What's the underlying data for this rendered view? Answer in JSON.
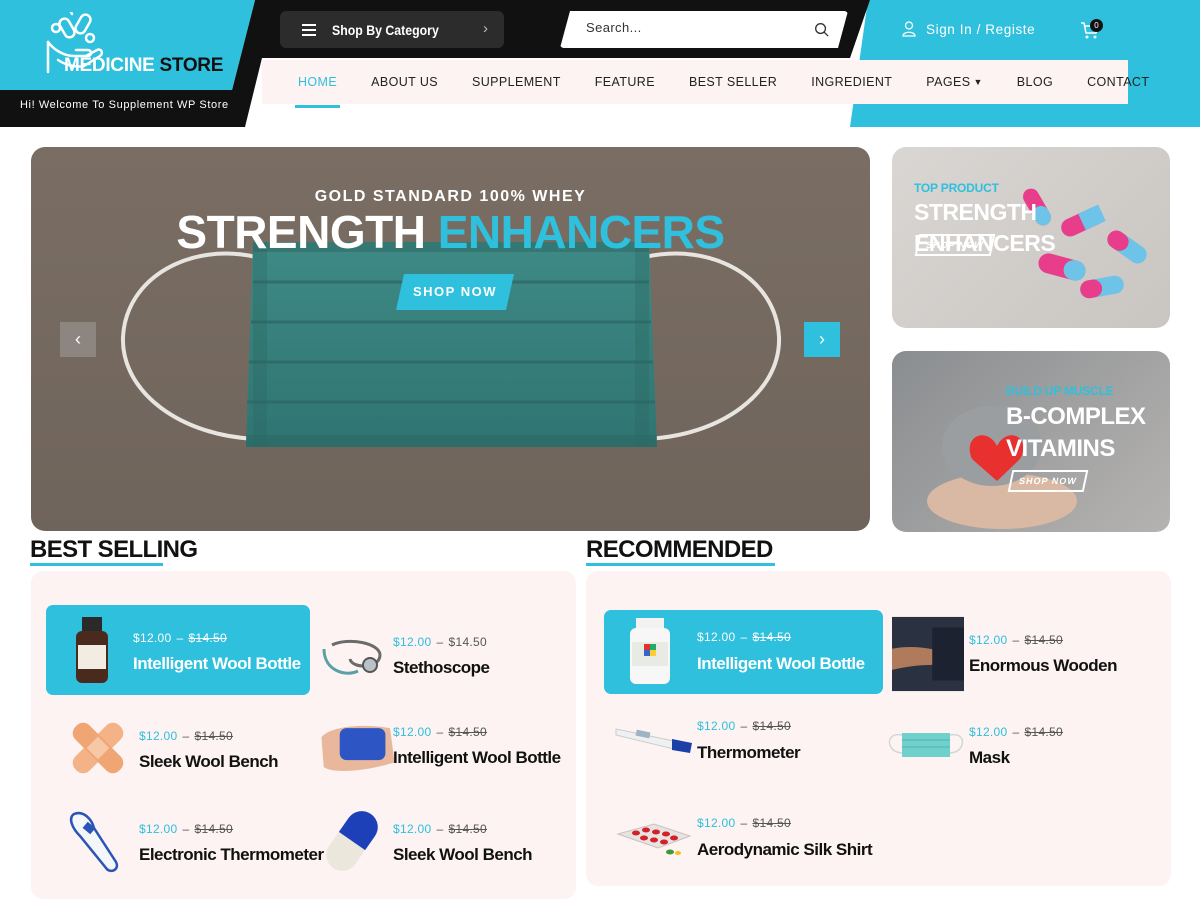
{
  "header": {
    "logo_main": "MEDICINE",
    "logo_store": "STORE",
    "welcome": "Hi! Welcome To Supplement WP Store",
    "category_button": "Shop By Category",
    "search_placeholder": "Search...",
    "signin": "Sign In / Registe",
    "cart_count": "0"
  },
  "nav": {
    "items": [
      "HOME",
      "ABOUT US",
      "SUPPLEMENT",
      "FEATURE",
      "BEST SELLER",
      "INGREDIENT",
      "PAGES",
      "BLOG",
      "CONTACT"
    ],
    "active": "HOME"
  },
  "hero": {
    "subtitle": "GOLD STANDARD 100% WHEY",
    "title_white": "STRENGTH",
    "title_accent": "ENHANCERS",
    "button": "SHOP NOW"
  },
  "side_banners": [
    {
      "tag": "TOP PRODUCT",
      "title": "STRENGTH ENHANCERS",
      "button": "SHOP NOW"
    },
    {
      "tag": "BUILD UP MUSCLE",
      "title_line1": "B-COMPLEX",
      "title_line2": "VITAMINS",
      "button": "SHOP NOW"
    }
  ],
  "best_selling": {
    "title": "BEST SELLING",
    "products": [
      {
        "price": "$12.00",
        "old_price": "$14.50",
        "name": "Intelligent Wool Bottle",
        "icon": "bottle-icon"
      },
      {
        "price": "$12.00",
        "old_price": "$14.50",
        "name": "Stethoscope",
        "icon": "stethoscope-icon"
      },
      {
        "price": "$12.00",
        "old_price": "$14.50",
        "name": "Sleek Wool Bench",
        "icon": "bandage-icon"
      },
      {
        "price": "$12.00",
        "old_price": "$14.50",
        "name": "Intelligent Wool Bottle",
        "icon": "wrap-icon"
      },
      {
        "price": "$12.00",
        "old_price": "$14.50",
        "name": "Electronic Thermometer",
        "icon": "ear-thermometer-icon"
      },
      {
        "price": "$12.00",
        "old_price": "$14.50",
        "name": "Sleek Wool Bench",
        "icon": "capsule-icon"
      }
    ]
  },
  "recommended": {
    "title": "RECOMMENDED",
    "products": [
      {
        "price": "$12.00",
        "old_price": "$14.50",
        "name": "Intelligent Wool Bottle",
        "icon": "jar-icon"
      },
      {
        "price": "$12.00",
        "old_price": "$14.50",
        "name": "Enormous Wooden",
        "icon": "bp-cuff-icon"
      },
      {
        "price": "$12.00",
        "old_price": "$14.50",
        "name": "Thermometer",
        "icon": "thermometer-icon"
      },
      {
        "price": "$12.00",
        "old_price": "$14.50",
        "name": "Mask",
        "icon": "mask-icon"
      },
      {
        "price": "$12.00",
        "old_price": "$14.50",
        "name": "Aerodynamic Silk Shirt",
        "icon": "pills-icon"
      }
    ]
  },
  "colors": {
    "accent": "#2ec0dd",
    "dark": "#111111",
    "panel": "#fdf3f2"
  }
}
